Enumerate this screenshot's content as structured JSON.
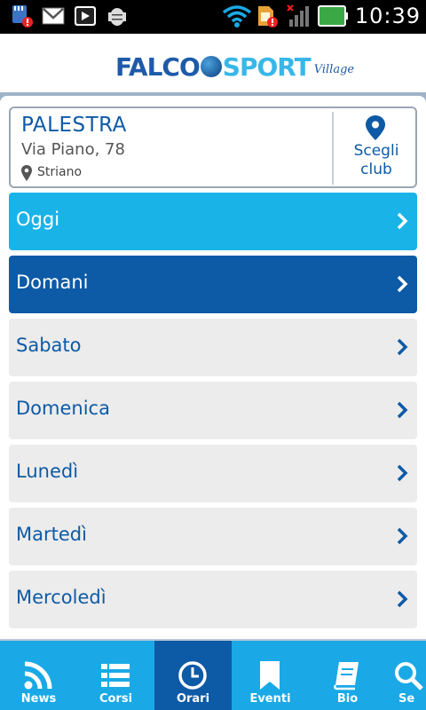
{
  "status_bar": {
    "time": "10:39",
    "icons": [
      "sd-card-alert-icon",
      "gmail-icon",
      "media-play-icon",
      "android-debug-icon",
      "wifi-icon",
      "sim-alert-icon",
      "no-signal-icon",
      "battery-icon"
    ]
  },
  "header": {
    "logo": {
      "part1": "FALCO",
      "part2": "SPORT",
      "part3": "Village"
    }
  },
  "club": {
    "name": "PALESTRA",
    "address": "Via Piano, 78",
    "city": "Striano",
    "choose_label_line1": "Scegli",
    "choose_label_line2": "club"
  },
  "days": [
    {
      "label": "Oggi",
      "state": "today"
    },
    {
      "label": "Domani",
      "state": "tomorrow"
    },
    {
      "label": "Sabato",
      "state": "normal"
    },
    {
      "label": "Domenica",
      "state": "normal"
    },
    {
      "label": "Lunedì",
      "state": "normal"
    },
    {
      "label": "Martedì",
      "state": "normal"
    },
    {
      "label": "Mercoledì",
      "state": "normal"
    }
  ],
  "tabs": [
    {
      "label": "News",
      "icon": "rss-icon"
    },
    {
      "label": "Corsi",
      "icon": "list-icon"
    },
    {
      "label": "Orari",
      "icon": "clock-icon",
      "active": true
    },
    {
      "label": "Eventi",
      "icon": "bookmark-icon"
    },
    {
      "label": "Bio",
      "icon": "book-icon"
    },
    {
      "label": "Se",
      "icon": "search-icon"
    }
  ],
  "colors": {
    "primary": "#0d5aa6",
    "accent": "#1ab3e8",
    "tabbar": "#1aa9e6",
    "row": "#ececec"
  }
}
